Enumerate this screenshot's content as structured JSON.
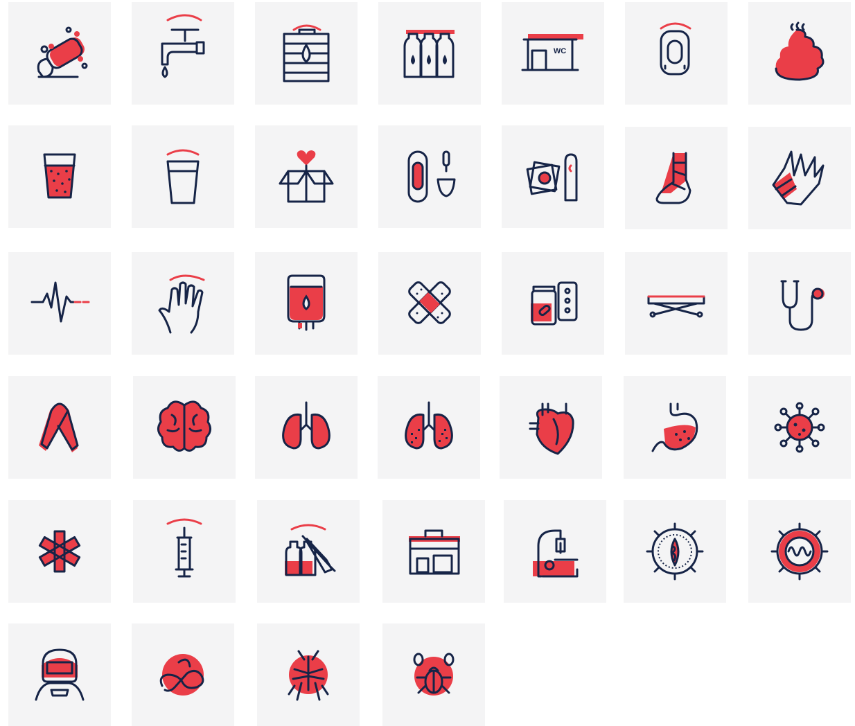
{
  "palette": {
    "navy": "#162447",
    "red": "#ea3e48",
    "tile": "#f4f4f5"
  },
  "signage": {
    "restroom_sign": "WC"
  },
  "icons": [
    "soap-icon",
    "faucet-icon",
    "water-tank-icon",
    "water-bottles-icon",
    "restroom-building-icon",
    "urinal-icon",
    "poop-icon",
    "dirty-water-glass-icon",
    "clean-water-glass-icon",
    "donation-box-icon",
    "menstrual-products-icon",
    "condoms-icon",
    "bandaged-foot-icon",
    "bandaged-hand-icon",
    "heartbeat-icon",
    "hand-icon",
    "blood-bag-icon",
    "bandages-icon",
    "medicine-pills-icon",
    "stretcher-icon",
    "stethoscope-icon",
    "awareness-ribbon-icon",
    "brain-icon",
    "lungs-icon",
    "damaged-lungs-icon",
    "heart-icon",
    "stomach-icon",
    "virus-icon",
    "star-of-life-icon",
    "syringe-icon",
    "vaccine-vials-icon",
    "first-aid-kit-icon",
    "microscope-icon",
    "virus-cell-icon",
    "coronavirus-icon",
    "protective-mask-icon",
    "worm-icon",
    "mosquito-icon",
    "bugs-icon"
  ]
}
